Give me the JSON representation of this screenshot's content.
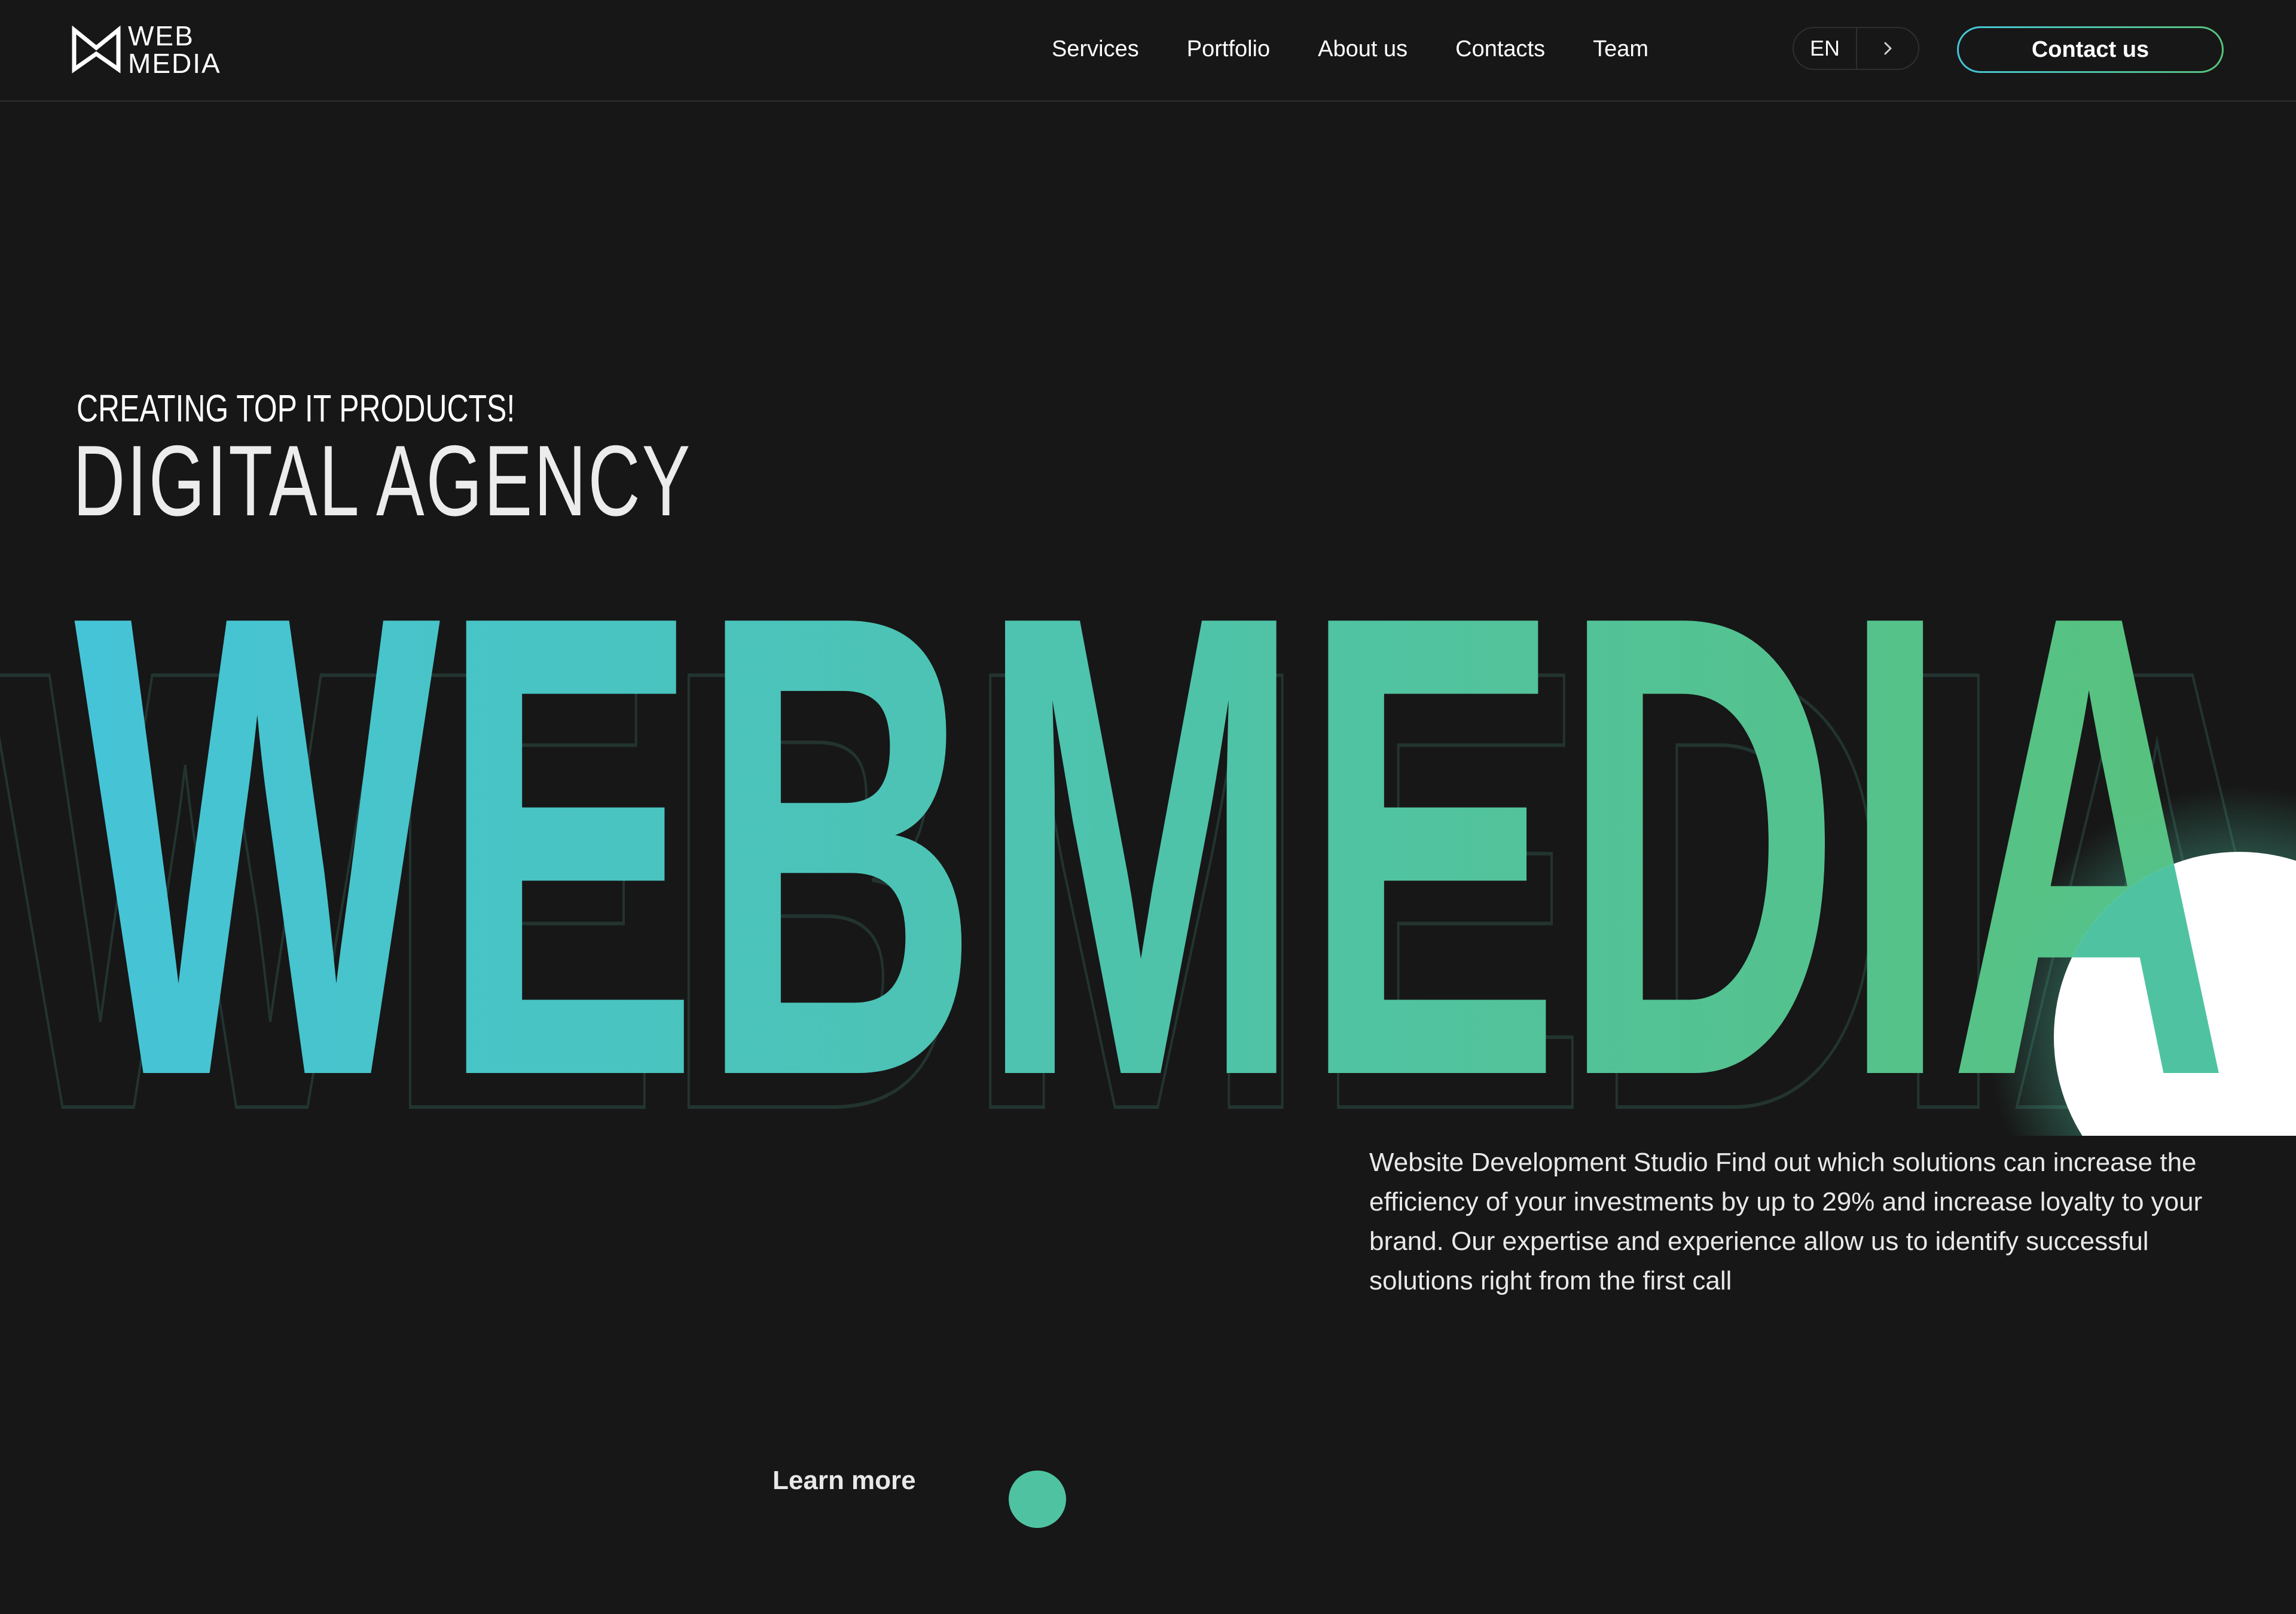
{
  "brand": {
    "logo_line1": "WEB",
    "logo_line2": "MEDIA"
  },
  "nav": {
    "items": [
      {
        "label": "Services"
      },
      {
        "label": "Portfolio"
      },
      {
        "label": "About us"
      },
      {
        "label": "Contacts"
      },
      {
        "label": "Team"
      }
    ]
  },
  "language": {
    "code": "EN",
    "icon": "chevron-right-icon"
  },
  "header": {
    "contact_label": "Contact us"
  },
  "hero": {
    "tagline": "CREATING TOP IT PRODUCTS!",
    "title": "DIGITAL AGENCY",
    "wordmark": "WEBMEDIA",
    "description": "Website Development Studio Find out which solutions can increase the efficiency of your investments by up to 29% and increase loyalty to your brand. Our expertise and experience allow us to identify successful solutions right from the first call",
    "learn_more": "Learn more"
  },
  "colors": {
    "background": "#171717",
    "gradient_start": "#45c4d8",
    "gradient_end": "#58c27c",
    "accent": "#4fc3a1",
    "cursor_blob": "#ffffff"
  }
}
